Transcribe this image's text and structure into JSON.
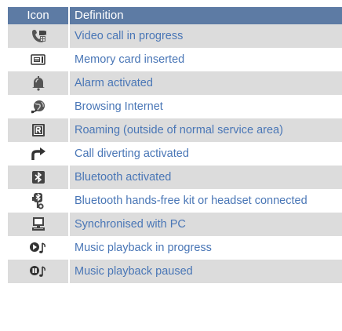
{
  "table": {
    "header": {
      "icon": "Icon",
      "definition": "Definition"
    },
    "rows": [
      {
        "icon": "video-call-icon",
        "definition": "Video call in progress"
      },
      {
        "icon": "memory-card-icon",
        "definition": "Memory card inserted"
      },
      {
        "icon": "alarm-bell-icon",
        "definition": "Alarm activated"
      },
      {
        "icon": "browsing-globe-icon",
        "definition": "Browsing Internet"
      },
      {
        "icon": "roaming-icon",
        "definition": "Roaming (outside of normal service area)"
      },
      {
        "icon": "call-divert-icon",
        "definition": "Call diverting activated"
      },
      {
        "icon": "bluetooth-icon",
        "definition": "Bluetooth activated"
      },
      {
        "icon": "bluetooth-headset-icon",
        "definition": "Bluetooth hands-free kit or headset connected"
      },
      {
        "icon": "pc-sync-icon",
        "definition": "Synchronised with PC"
      },
      {
        "icon": "music-play-icon",
        "definition": "Music playback in progress"
      },
      {
        "icon": "music-pause-icon",
        "definition": "Music playback paused"
      }
    ]
  },
  "colors": {
    "header_bg": "#5d7ba4",
    "header_text": "#ffffff",
    "row_shade": "#dcdcdc",
    "definition_text": "#4976b6"
  }
}
